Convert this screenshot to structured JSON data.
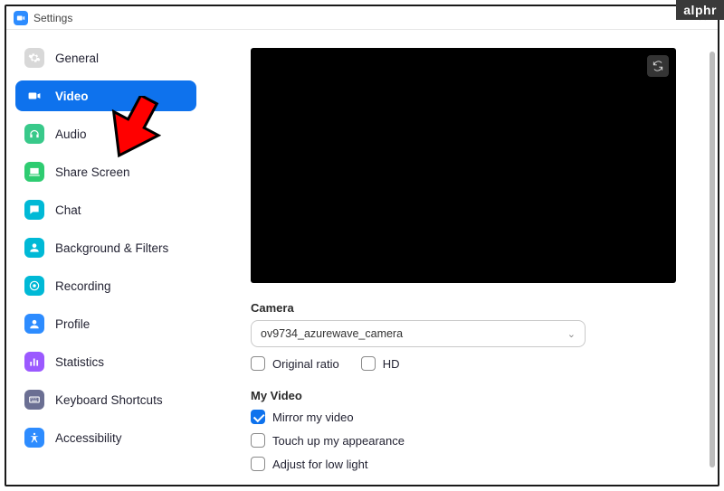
{
  "window": {
    "title": "Settings"
  },
  "badge": "alphr",
  "sidebar": {
    "items": [
      {
        "label": "General",
        "icon": "gear",
        "color": "#d8d8d8",
        "active": false
      },
      {
        "label": "Video",
        "icon": "video",
        "color": "#ffffff",
        "active": true
      },
      {
        "label": "Audio",
        "icon": "headphones",
        "color": "#38c98a",
        "active": false
      },
      {
        "label": "Share Screen",
        "icon": "share",
        "color": "#2ecc71",
        "active": false
      },
      {
        "label": "Chat",
        "icon": "chat",
        "color": "#00b9d6",
        "active": false
      },
      {
        "label": "Background & Filters",
        "icon": "person",
        "color": "#00b9d6",
        "active": false
      },
      {
        "label": "Recording",
        "icon": "record",
        "color": "#00b9d6",
        "active": false
      },
      {
        "label": "Profile",
        "icon": "profile",
        "color": "#2D8CFF",
        "active": false
      },
      {
        "label": "Statistics",
        "icon": "stats",
        "color": "#9b59ff",
        "active": false
      },
      {
        "label": "Keyboard Shortcuts",
        "icon": "keyboard",
        "color": "#6b6f93",
        "active": false
      },
      {
        "label": "Accessibility",
        "icon": "accessibility",
        "color": "#2D8CFF",
        "active": false
      }
    ]
  },
  "content": {
    "camera_label": "Camera",
    "camera_selected": "ov9734_azurewave_camera",
    "original_ratio": {
      "label": "Original ratio",
      "checked": false
    },
    "hd": {
      "label": "HD",
      "checked": false
    },
    "my_video_label": "My Video",
    "mirror": {
      "label": "Mirror my video",
      "checked": true
    },
    "touchup": {
      "label": "Touch up my appearance",
      "checked": false
    },
    "lowlight": {
      "label": "Adjust for low light",
      "checked": false
    }
  }
}
